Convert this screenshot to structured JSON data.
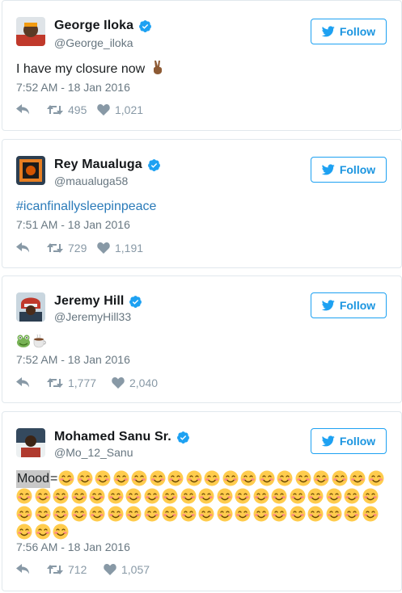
{
  "follow_label": "Follow",
  "tweets": [
    {
      "name": "George Iloka",
      "handle": "@George_iloka",
      "text": "I have my closure now",
      "text_emoji": "victory-hand-brown",
      "time": "7:52 AM - 18 Jan 2016",
      "retweets": "495",
      "likes": "1,021"
    },
    {
      "name": "Rey Maualuga",
      "handle": "@maualuga58",
      "text": "#icanfinallysleepinpeace",
      "time": "7:51 AM - 18 Jan 2016",
      "retweets": "729",
      "likes": "1,191"
    },
    {
      "name": "Jeremy Hill",
      "handle": "@JeremyHill33",
      "text_emoji": [
        "frog-face",
        "hot-beverage"
      ],
      "time": "7:52 AM - 18 Jan 2016",
      "retweets": "1,777",
      "likes": "2,040"
    },
    {
      "name": "Mohamed Sanu Sr.",
      "handle": "@Mo_12_Sanu",
      "text": "Mood",
      "text_suffix": "=",
      "smile_count": 61,
      "time": "7:56 AM - 18 Jan 2016",
      "retweets": "712",
      "likes": "1,057"
    }
  ],
  "colors": {
    "accent": "#1da1f2",
    "name": "#14171a",
    "meta": "#697882",
    "hashtag": "#2b7bb9",
    "border": "#e1e8ed"
  }
}
